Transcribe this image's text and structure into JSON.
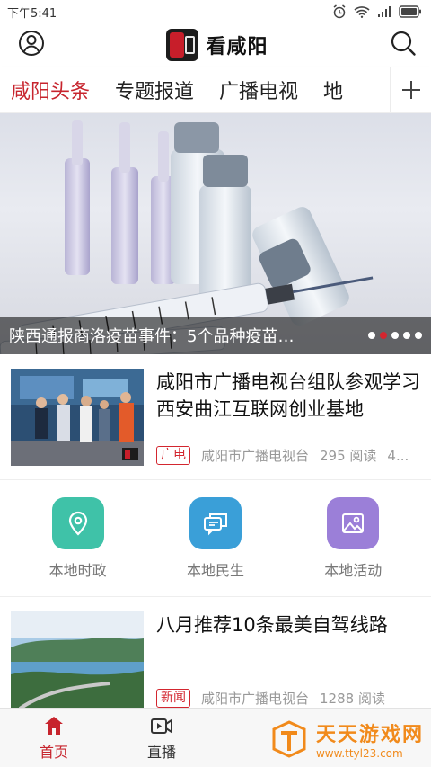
{
  "status_bar": {
    "time": "下午5:41"
  },
  "header": {
    "app_name": "看咸阳"
  },
  "tabs": [
    {
      "label": "咸阳头条",
      "active": true
    },
    {
      "label": "专题报道",
      "active": false
    },
    {
      "label": "广播电视",
      "active": false
    },
    {
      "label": "地",
      "active": false
    }
  ],
  "banner": {
    "title": "陕西通报商洛疫苗事件：5个品种疫苗…",
    "slide_count": 5,
    "active_slide": 2
  },
  "news": [
    {
      "title": "咸阳市广播电视台组队参观学习西安曲江互联网创业基地",
      "tag": "广电",
      "source": "咸阳市广播电视台",
      "reads": "295 阅读",
      "extra": "4..."
    },
    {
      "title": "八月推荐10条最美自驾线路",
      "tag": "新闻",
      "source": "咸阳市广播电视台",
      "reads": "1288 阅读"
    }
  ],
  "categories": [
    {
      "label": "本地时政",
      "icon": "location-pin-icon",
      "color": "#3fc2a8"
    },
    {
      "label": "本地民生",
      "icon": "chat-bubbles-icon",
      "color": "#3a9fd8"
    },
    {
      "label": "本地活动",
      "icon": "image-icon",
      "color": "#9b7fd8"
    }
  ],
  "bottom_nav": [
    {
      "label": "首页",
      "icon": "home-icon",
      "active": true
    },
    {
      "label": "直播",
      "icon": "live-video-icon",
      "active": false
    }
  ],
  "watermark": {
    "title": "天天游戏网",
    "url": "www.ttyl23.com"
  },
  "colors": {
    "accent": "#c7242d",
    "watermark": "#f18a1b"
  }
}
